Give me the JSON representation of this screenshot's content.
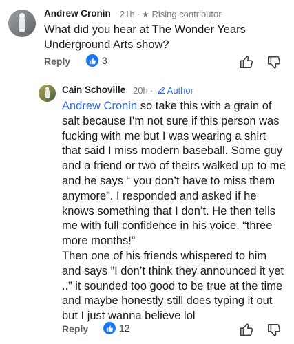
{
  "comment1": {
    "author": "Andrew Cronin",
    "time": "21h",
    "badge": "Rising contributor",
    "text_line1": "What did you hear at The Wonder Years",
    "text_line2": "Underground Arts show?",
    "reply_label": "Reply",
    "likes": "3"
  },
  "comment2": {
    "author": "Cain Schoville",
    "time": "20h",
    "badge": "Author",
    "mention": "Andrew Cronin",
    "text_lines": [
      " so take this with a grain of",
      "salt because I’m not sure if this person was",
      "fucking with me but I was wearing a shirt",
      "that said I miss modern baseball. Some guy",
      "and a friend or two of theirs walked up to me",
      "and he says “ you don’t have to miss them",
      "anymore”.   I responded and asked if he",
      "knows something that I don’t. He then tells",
      "me with full confidence in his voice, “three",
      "more months!”",
      "Then one of his friends whispered to him",
      "and says ”I don’t think they announced it yet",
      "..” it sounded too good to be true at the time",
      "and maybe honestly still does typing it out",
      "but I just wanna believe lol"
    ],
    "reply_label": "Reply",
    "likes": "12"
  },
  "colors": {
    "accent": "#2f6fde",
    "like": "#1877f2",
    "meta": "#7a7a7f"
  },
  "icons": [
    "star-icon",
    "pencil-icon",
    "thumbs-up-icon",
    "thumbs-down-icon",
    "like-reaction-icon"
  ]
}
